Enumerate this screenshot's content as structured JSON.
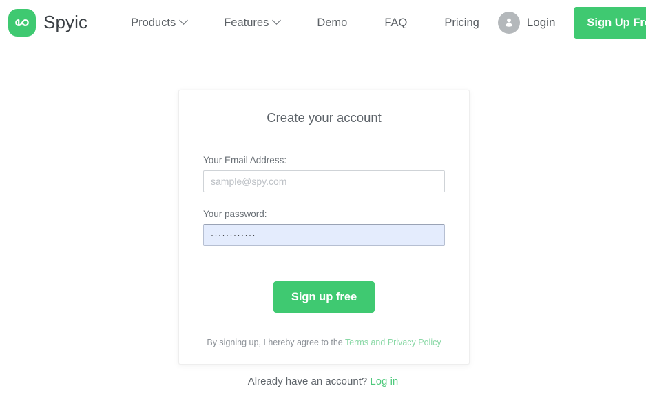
{
  "header": {
    "brand": {
      "name": "Spyic",
      "logo_icon": "infinity-icon",
      "logo_color": "#3fc971"
    },
    "nav": [
      {
        "label": "Products",
        "has_dropdown": true,
        "icon": "chevron-down-icon"
      },
      {
        "label": "Features",
        "has_dropdown": true,
        "icon": "chevron-down-icon"
      },
      {
        "label": "Demo",
        "has_dropdown": false
      },
      {
        "label": "FAQ",
        "has_dropdown": false
      },
      {
        "label": "Pricing",
        "has_dropdown": false
      }
    ],
    "login": {
      "label": "Login",
      "avatar_icon": "user-avatar-icon"
    },
    "signup_button": {
      "label": "Sign Up Free",
      "color": "#3fc971"
    }
  },
  "signup_card": {
    "title": "Create your account",
    "email_field": {
      "label": "Your Email Address:",
      "placeholder": "sample@spy.com",
      "value": ""
    },
    "password_field": {
      "label": "Your password:",
      "placeholder": "",
      "value": "············",
      "autofill_background": "#e4ecfd"
    },
    "submit_button": {
      "label": "Sign up free",
      "color": "#3fc971"
    },
    "terms": {
      "text": "By signing up, I hereby agree to the ",
      "link_label": "Terms and Privacy Policy",
      "link_color": "#8ad8a6"
    }
  },
  "footer": {
    "prompt": "Already have an account? ",
    "login_link": "Log in",
    "link_color": "#4fc97c"
  }
}
